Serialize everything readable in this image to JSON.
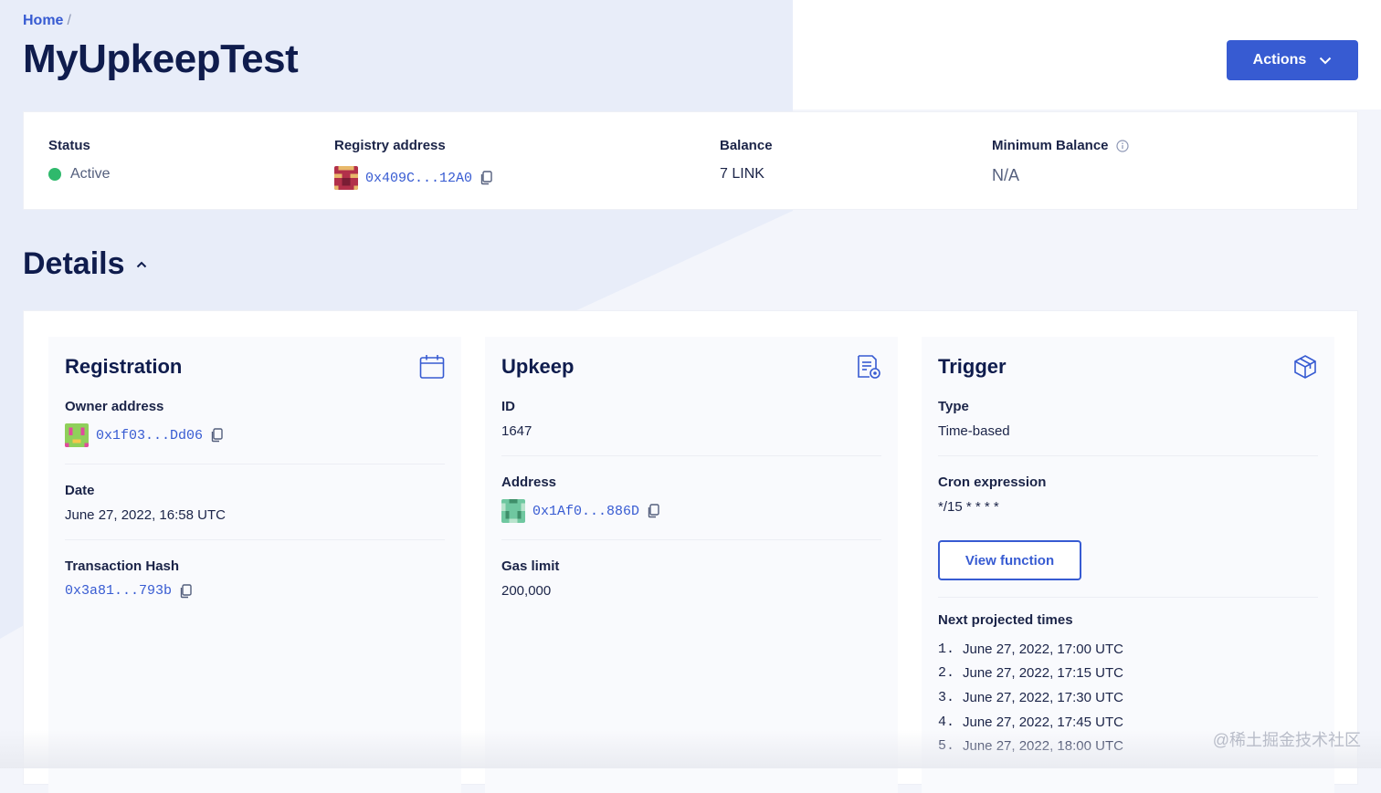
{
  "breadcrumb": {
    "home": "Home",
    "separator": "/"
  },
  "page": {
    "title": "MyUpkeepTest"
  },
  "actions": {
    "label": "Actions"
  },
  "summary": {
    "status": {
      "label": "Status",
      "value": "Active",
      "color": "#2fb96c"
    },
    "registry": {
      "label": "Registry address",
      "value": "0x409C...12A0"
    },
    "balance": {
      "label": "Balance",
      "value": "7 LINK"
    },
    "min_balance": {
      "label": "Minimum Balance",
      "value": "N/A"
    }
  },
  "details": {
    "heading": "Details"
  },
  "registration": {
    "title": "Registration",
    "owner_label": "Owner address",
    "owner_value": "0x1f03...Dd06",
    "date_label": "Date",
    "date_value": "June 27, 2022, 16:58 UTC",
    "tx_label": "Transaction Hash",
    "tx_value": "0x3a81...793b"
  },
  "upkeep": {
    "title": "Upkeep",
    "id_label": "ID",
    "id_value": "1647",
    "address_label": "Address",
    "address_value": "0x1Af0...886D",
    "gas_label": "Gas limit",
    "gas_value": "200,000"
  },
  "trigger": {
    "title": "Trigger",
    "type_label": "Type",
    "type_value": "Time-based",
    "cron_label": "Cron expression",
    "cron_value": "*/15 * * * *",
    "view_button": "View function",
    "next_label": "Next projected times",
    "times": [
      {
        "n": "1.",
        "t": "June 27, 2022, 17:00 UTC"
      },
      {
        "n": "2.",
        "t": "June 27, 2022, 17:15 UTC"
      },
      {
        "n": "3.",
        "t": "June 27, 2022, 17:30 UTC"
      },
      {
        "n": "4.",
        "t": "June 27, 2022, 17:45 UTC"
      },
      {
        "n": "5.",
        "t": "June 27, 2022, 18:00 UTC"
      }
    ]
  },
  "icons": {
    "calendar": "calendar-icon",
    "document": "document-settings-icon",
    "cube": "cube-icon",
    "copy": "copy-icon",
    "chevron": "chevron-down-icon",
    "info": "info-icon"
  },
  "colors": {
    "accent": "#375bd2",
    "heading": "#0f1c4d",
    "success": "#2fb96c"
  },
  "watermark": "@稀土掘金技术社区"
}
